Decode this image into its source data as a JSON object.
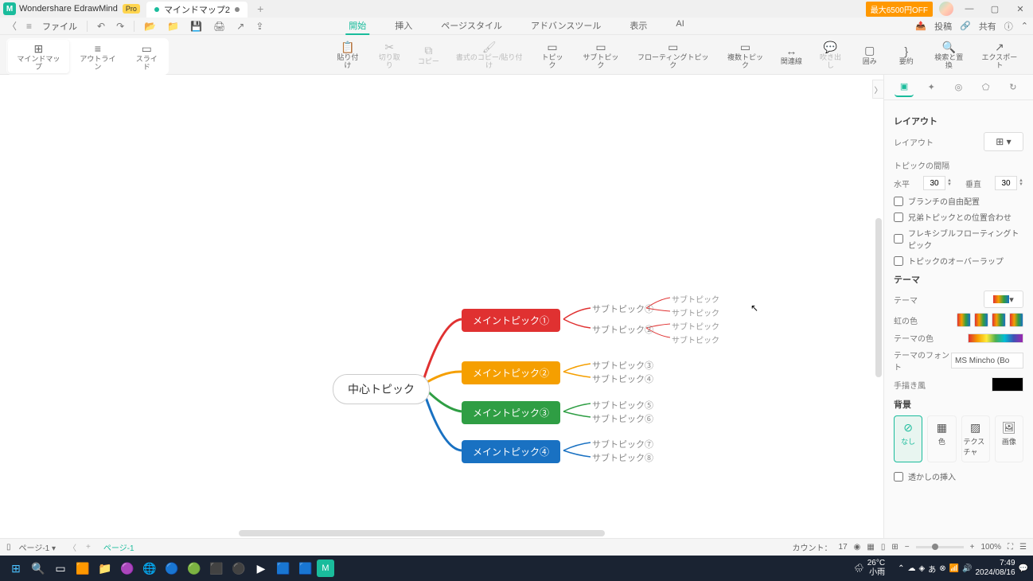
{
  "titlebar": {
    "app_name": "Wondershare EdrawMind",
    "pro_badge": "Pro",
    "tab_name": "マインドマップ2",
    "promo": "最大6500円OFF"
  },
  "menurow": {
    "file": "ファイル",
    "main_tabs": [
      "開始",
      "挿入",
      "ページスタイル",
      "アドバンスツール",
      "表示",
      "AI"
    ],
    "post": "投稿",
    "share": "共有"
  },
  "toolbar_left": [
    {
      "label": "マインドマップ",
      "icon": "⊞"
    },
    {
      "label": "アウトライン",
      "icon": "≡"
    },
    {
      "label": "スライド",
      "icon": "▭"
    }
  ],
  "toolbar_mid": [
    {
      "label": "貼り付け",
      "icon": "📋",
      "sub": "貼り付け"
    },
    {
      "label": "切り取り",
      "icon": "✂",
      "disabled": true
    },
    {
      "label": "コピー",
      "icon": "⧉",
      "disabled": true
    },
    {
      "label": "書式のコピー/貼り付け",
      "icon": "🖌",
      "disabled": true
    },
    {
      "label": "トピック",
      "icon": "▭"
    },
    {
      "label": "サブトピック",
      "icon": "▭"
    },
    {
      "label": "フローティングトピック",
      "icon": "▭"
    },
    {
      "label": "複数トピック",
      "icon": "▭"
    },
    {
      "label": "関連線",
      "icon": "↔"
    },
    {
      "label": "吹き出し",
      "icon": "💬",
      "disabled": true
    },
    {
      "label": "囲み",
      "icon": "▢"
    },
    {
      "label": "要約",
      "icon": "}"
    },
    {
      "label": "検索と置換",
      "icon": "🔍"
    }
  ],
  "toolbar_right": {
    "label": "エクスポート",
    "icon": "↗"
  },
  "mindmap": {
    "center": "中心トピック",
    "mains": [
      "メイントピック①",
      "メイントピック②",
      "メイントピック③",
      "メイントピック④"
    ],
    "subs1": [
      "サブトピック①",
      "サブトピック②"
    ],
    "subs2": [
      "サブトピック③",
      "サブトピック④"
    ],
    "subs3": [
      "サブトピック⑤",
      "サブトピック⑥"
    ],
    "subs4": [
      "サブトピック⑦",
      "サブトピック⑧"
    ],
    "subsubs": [
      "サブトピック",
      "サブトピック",
      "サブトピック",
      "サブトピック"
    ]
  },
  "panel": {
    "section_layout": "レイアウト",
    "layout_label": "レイアウト",
    "spacing_title": "トピックの間隔",
    "horiz": "水平",
    "horiz_val": "30",
    "vert": "垂直",
    "vert_val": "30",
    "chk1": "ブランチの自由配置",
    "chk2": "兄弟トピックとの位置合わせ",
    "chk3": "フレキシブルフローティングトピック",
    "chk4": "トピックのオーバーラップ",
    "section_theme": "テーマ",
    "theme_label": "テーマ",
    "rainbow": "虹の色",
    "theme_color": "テーマの色",
    "theme_font": "テーマのフォント",
    "font_val": "MS Mincho (Bo",
    "hand_drawn": "手描き風",
    "section_bg": "背景",
    "bg_none": "なし",
    "bg_color": "色",
    "bg_texture": "テクスチャ",
    "bg_image": "画像",
    "watermark": "透かしの挿入"
  },
  "bottombar": {
    "page_label": "ページ-1",
    "active_page": "ページ-1",
    "count_label": "カウント：",
    "count_val": "17",
    "zoom": "100%"
  },
  "taskbar": {
    "temp": "26°C",
    "weather": "小雨",
    "ime": [
      "あ",
      "⊗"
    ],
    "time": "7:49",
    "date": "2024/08/16"
  }
}
